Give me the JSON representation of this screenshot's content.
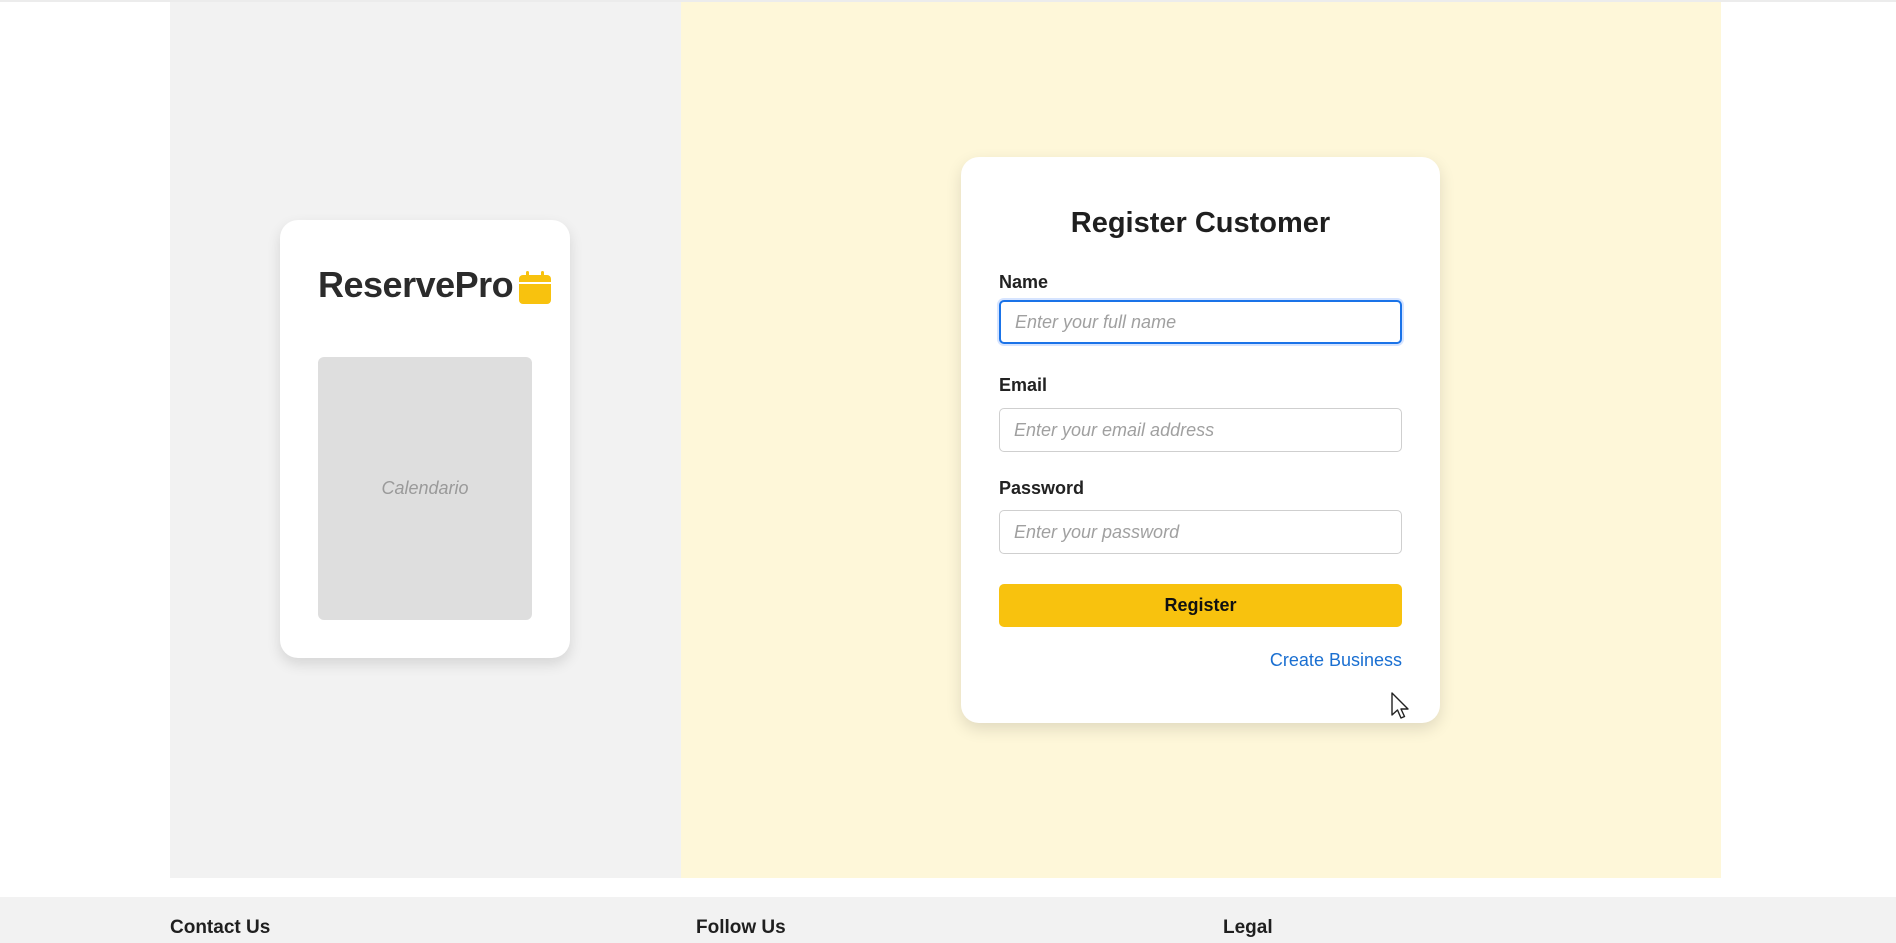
{
  "brand": {
    "name": "ReservePro",
    "icon": "calendar-icon",
    "accent_color": "#F8C20E"
  },
  "image_placeholder": {
    "label": "Calendario"
  },
  "form": {
    "title": "Register Customer",
    "fields": {
      "name": {
        "label": "Name",
        "placeholder": "Enter your full name",
        "value": ""
      },
      "email": {
        "label": "Email",
        "placeholder": "Enter your email address",
        "value": ""
      },
      "password": {
        "label": "Password",
        "placeholder": "Enter your password",
        "value": ""
      }
    },
    "submit_label": "Register",
    "secondary_link": "Create Business",
    "link_color": "#1A6FD1"
  },
  "footer": {
    "contact_heading": "Contact Us",
    "follow_heading": "Follow Us",
    "legal_heading": "Legal"
  }
}
